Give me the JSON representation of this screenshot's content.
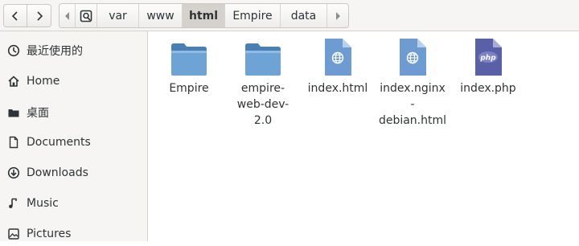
{
  "header": {
    "path": [
      "var",
      "www",
      "html",
      "Empire",
      "data"
    ],
    "active_crumb": "html"
  },
  "sidebar": {
    "items": [
      {
        "label": "最近使用的",
        "icon": "clock-icon"
      },
      {
        "label": "Home",
        "icon": "home-icon"
      },
      {
        "label": "桌面",
        "icon": "desktop-icon"
      },
      {
        "label": "Documents",
        "icon": "document-icon"
      },
      {
        "label": "Downloads",
        "icon": "download-icon"
      },
      {
        "label": "Music",
        "icon": "music-icon"
      },
      {
        "label": "Pictures",
        "icon": "picture-icon"
      }
    ]
  },
  "files": [
    {
      "name": "Empire",
      "type": "folder"
    },
    {
      "name": "empire-web-dev-2.0",
      "type": "folder"
    },
    {
      "name": "index.html",
      "type": "html"
    },
    {
      "name": "index.nginx-debian.html",
      "type": "html"
    },
    {
      "name": "index.php",
      "type": "php",
      "badge": "php"
    }
  ],
  "colors": {
    "folder": "#5b93c9",
    "folder_tab": "#4a7fb3",
    "html_doc": "#6e9bd1",
    "php_doc": "#5a60a8"
  }
}
